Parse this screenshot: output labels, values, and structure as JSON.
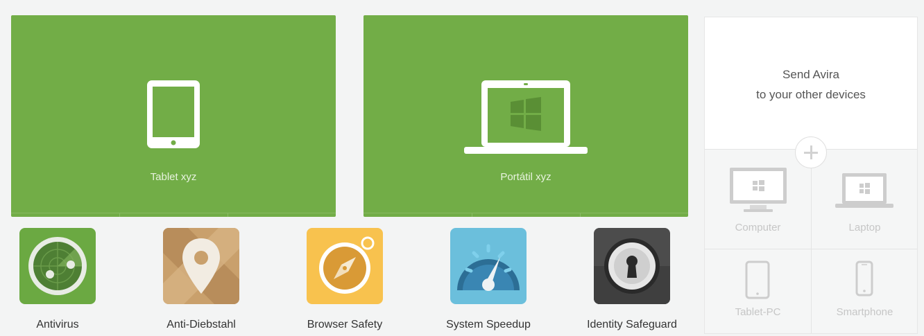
{
  "devices": [
    {
      "label": "Tablet xyz",
      "icon": "tablet-icon"
    },
    {
      "label": "Portátil xyz",
      "icon": "laptop-windows-icon"
    }
  ],
  "features": [
    {
      "label": "Antivirus",
      "icon": "radar-icon"
    },
    {
      "label": "Anti-Diebstahl",
      "icon": "map-pin-icon"
    },
    {
      "label": "Browser Safety",
      "icon": "compass-icon"
    },
    {
      "label": "System Speedup",
      "icon": "speedometer-icon"
    },
    {
      "label": "Identity Safeguard",
      "icon": "keyhole-icon"
    }
  ],
  "send_panel": {
    "title_line1": "Send Avira",
    "title_line2": "to your other devices",
    "add_icon": "plus-icon",
    "targets": [
      {
        "label": "Computer",
        "icon": "computer-icon"
      },
      {
        "label": "Laptop",
        "icon": "laptop-icon"
      },
      {
        "label": "Tablet-PC",
        "icon": "tablet-icon"
      },
      {
        "label": "Smartphone",
        "icon": "smartphone-icon"
      }
    ]
  },
  "colors": {
    "accent_green": "#72ad47",
    "background": "#f3f4f4",
    "panel": "#ffffff",
    "muted_text": "#c6c6c6"
  }
}
